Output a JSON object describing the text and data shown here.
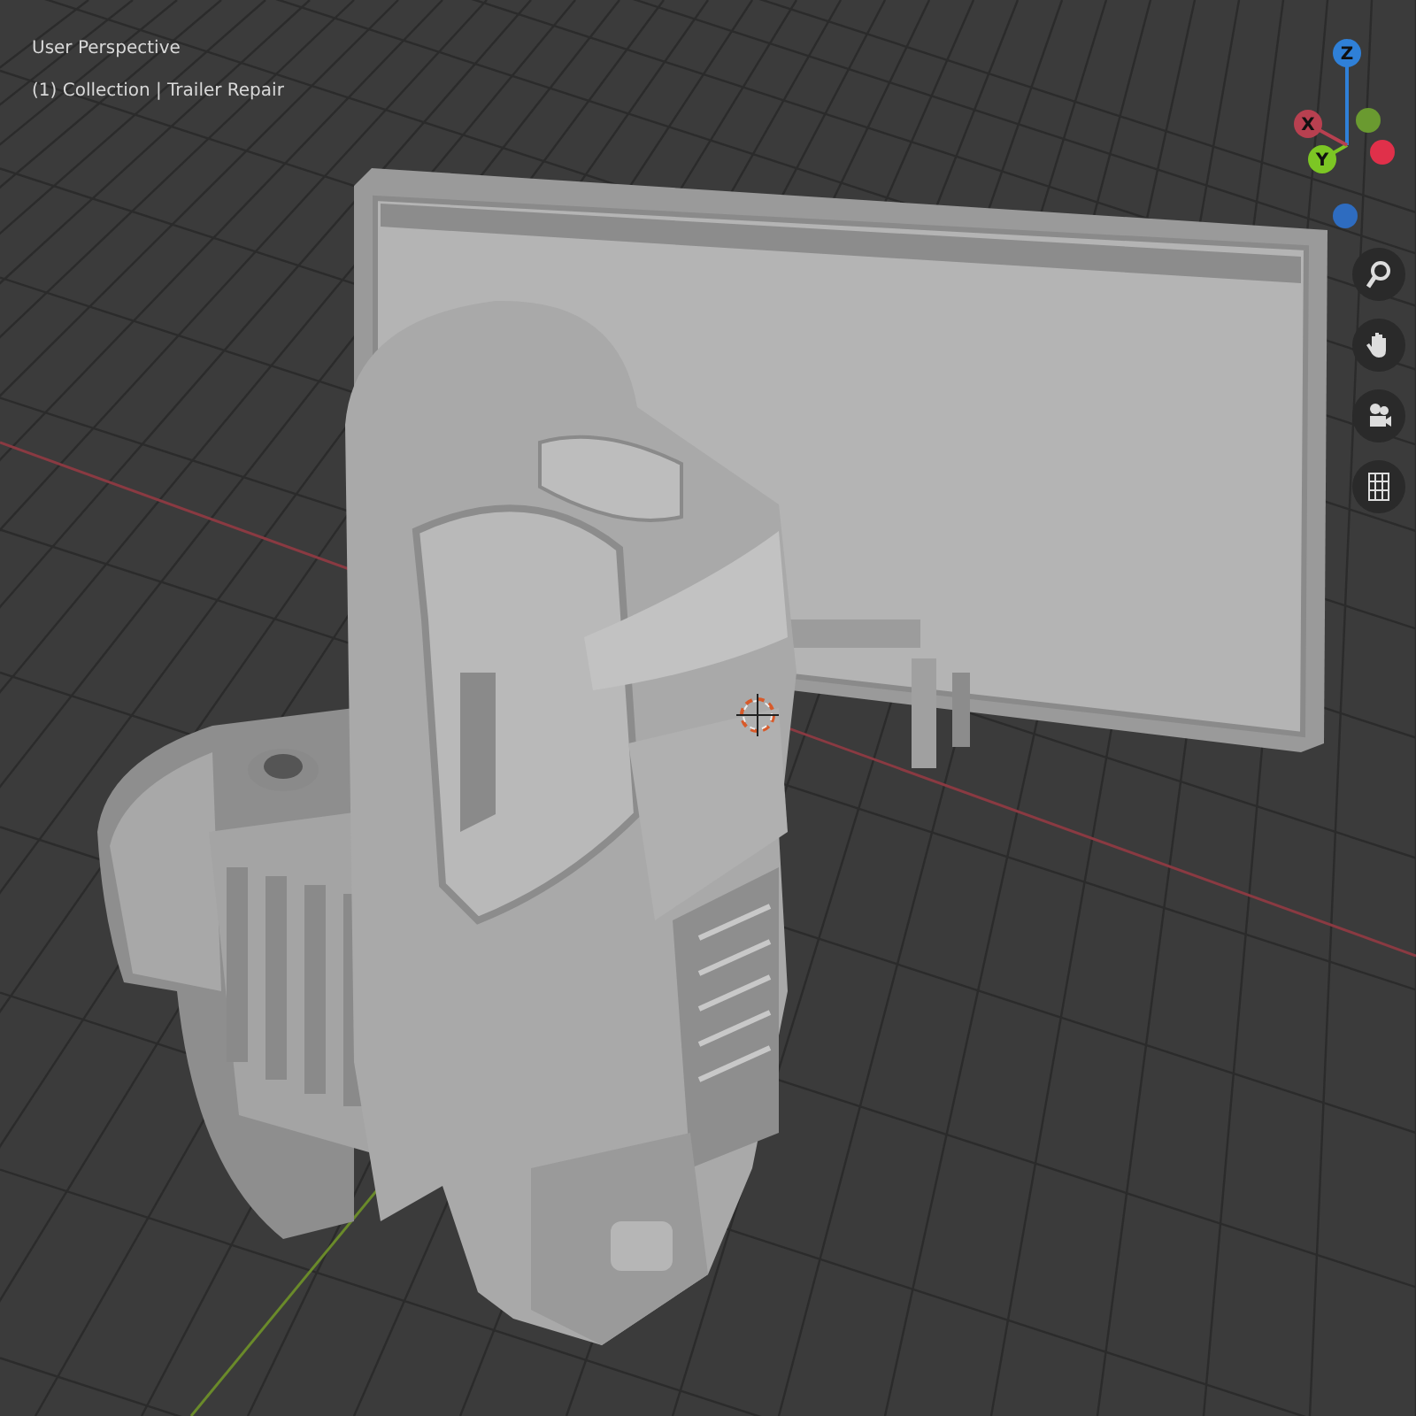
{
  "viewport": {
    "view_name": "User Perspective",
    "collection_label": "(1) Collection | Trailer Repair"
  },
  "gizmo": {
    "bubbles": [
      {
        "kind": "labeled",
        "label": "Z",
        "color": "#2f80d8"
      },
      {
        "kind": "labeled",
        "label": "X",
        "color": "#b84050"
      },
      {
        "kind": "plain",
        "color": "#6a9a30"
      },
      {
        "kind": "plain",
        "color": "#e0304a"
      },
      {
        "kind": "labeled",
        "label": "Y",
        "color": "#7cc624"
      },
      {
        "kind": "plain",
        "color": "#2e6cc0"
      }
    ]
  }
}
